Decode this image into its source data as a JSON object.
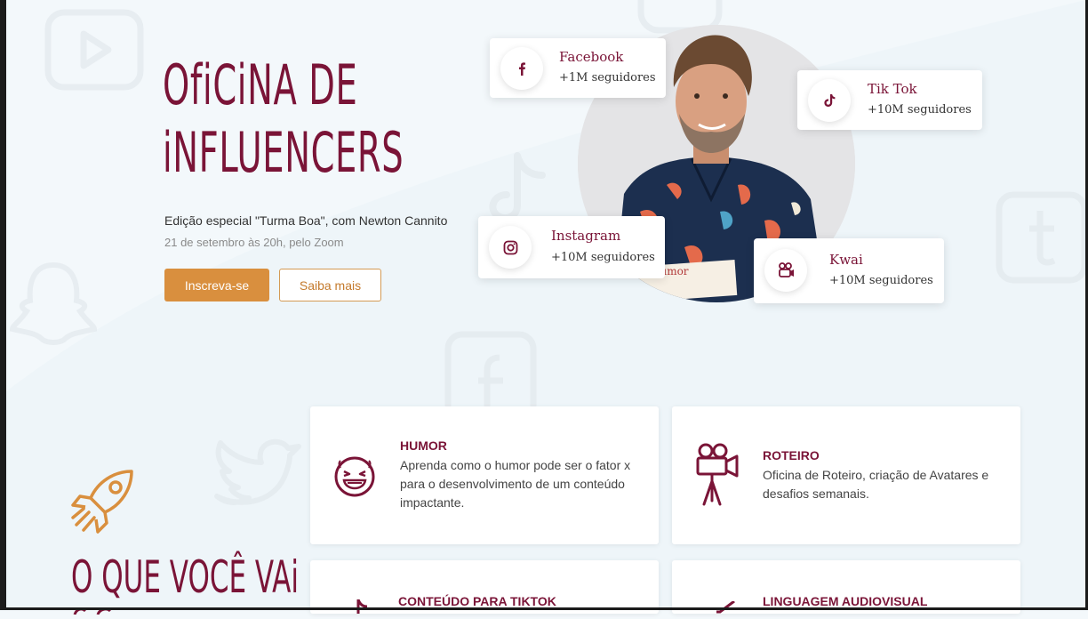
{
  "hero": {
    "title_line1": "OfiCiNA DE",
    "title_line2": "iNFLUENCERS",
    "subtitle": "Edição especial \"Turma Boa\", com Newton Cannito",
    "date": "21 de setembro às 20h, pelo Zoom",
    "primary_button": "Inscreva-se",
    "secondary_button": "Saiba mais",
    "photo_sign_text": "Humor"
  },
  "socials": [
    {
      "name": "Facebook",
      "count": "+1M seguidores",
      "icon": "facebook-icon"
    },
    {
      "name": "Tik Tok",
      "count": "+10M seguidores",
      "icon": "tiktok-icon"
    },
    {
      "name": "Instagram",
      "count": "+10M seguidores",
      "icon": "instagram-icon"
    },
    {
      "name": "Kwai",
      "count": "+10M seguidores",
      "icon": "kwai-icon"
    }
  ],
  "features": [
    {
      "title": "HUMOR",
      "description": "Aprenda como o humor pode ser o fator x para o desenvolvimento de um conteúdo impactante.",
      "icon": "laughing-face-icon"
    },
    {
      "title": "ROTEIRO",
      "description": "Oficina de Roteiro, criação de Avatares e desafios semanais.",
      "icon": "movie-camera-icon"
    },
    {
      "title": "CONTEÚDO PARA TIKTOK",
      "description": "",
      "icon": "tiktok-icon"
    },
    {
      "title": "LINGUAGEM AUDIOVISUAL",
      "description": "",
      "icon": "megaphone-icon"
    }
  ],
  "section": {
    "title": "O QUE VOCÊ VAi",
    "icon": "rocket-icon"
  },
  "colors": {
    "brand": "#7a1437",
    "accent": "#d98f3e",
    "background": "#f3f8fb"
  }
}
